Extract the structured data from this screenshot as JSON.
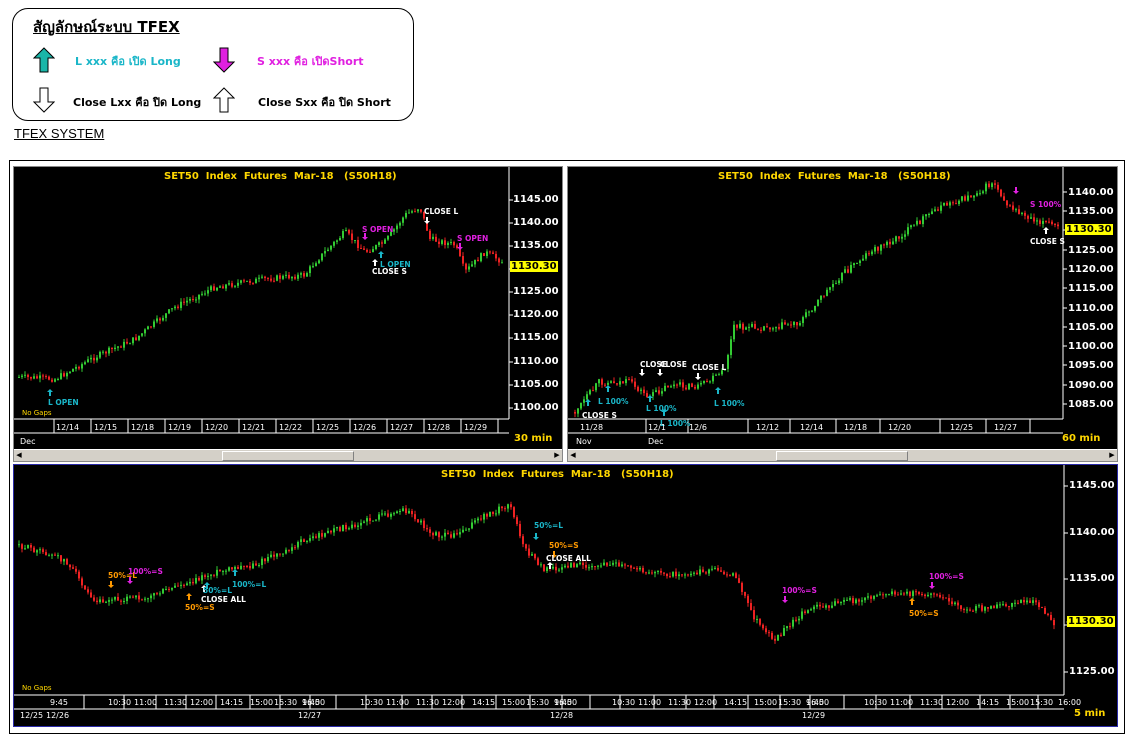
{
  "legend": {
    "title": "สัญลักษณ์ระบบ TFEX",
    "items": [
      {
        "label": "L xxx คือ เปิด Long",
        "color": "#1ab6c8",
        "icon": "up-arrow-teal"
      },
      {
        "label": "S xxx คือ เปิดShort",
        "color": "#e020e0",
        "icon": "down-arrow-magenta"
      },
      {
        "label": "Close Lxx คือ ปิด Long",
        "color": "#000000",
        "icon": "down-arrow-white"
      },
      {
        "label": "Close Sxx คือ ปิด Short",
        "color": "#000000",
        "icon": "up-arrow-white"
      }
    ]
  },
  "system_title": "TFEX SYSTEM",
  "colors": {
    "up": "#33cc33",
    "down": "#ee2222",
    "title": "#ffd700",
    "last_price_bg": "#ffff00",
    "long": "#1ab6c8",
    "short": "#e020e0",
    "half": "#ff9900",
    "close": "#ffffff"
  },
  "panels": [
    {
      "title": "SET50  Index  Futures  Mar-18   (S50H18)",
      "interval": "30  min",
      "no_gaps": "No Gaps",
      "last_price": "1130.30",
      "yticks": [
        "1145.00",
        "1140.00",
        "1135.00",
        "1130.00",
        "1125.00",
        "1120.00",
        "1115.00",
        "1110.00",
        "1105.00",
        "1100.00"
      ],
      "xticks": [
        "12/14",
        "12/15",
        "12/18",
        "12/19",
        "12/20",
        "12/21",
        "12/22",
        "12/25",
        "12/26",
        "12/27",
        "12/28",
        "12/29"
      ],
      "months": [
        "Dec"
      ],
      "signals": [
        {
          "text": "L  OPEN",
          "color": "#1ab6c8"
        },
        {
          "text": "S  OPEN",
          "color": "#e020e0"
        },
        {
          "text": "L  OPEN",
          "color": "#1ab6c8"
        },
        {
          "text": "CLOSE  S",
          "color": "#ffffff"
        },
        {
          "text": "CLOSE  L",
          "color": "#ffffff"
        },
        {
          "text": "S  OPEN",
          "color": "#e020e0"
        }
      ]
    },
    {
      "title": "SET50  Index  Futures  Mar-18   (S50H18)",
      "interval": "60  min",
      "last_price": "1130.30",
      "yticks": [
        "1140.00",
        "1135.00",
        "1130.00",
        "1125.00",
        "1120.00",
        "1115.00",
        "1110.00",
        "1105.00",
        "1100.00",
        "1095.00",
        "1090.00",
        "1085.00"
      ],
      "xticks": [
        "11/28",
        "12/1",
        "12/6",
        "12/12",
        "12/14",
        "12/18",
        "12/20",
        "12/25",
        "12/27"
      ],
      "months": [
        "Nov",
        "Dec"
      ],
      "signals": [
        {
          "text": "L  100%",
          "color": "#1ab6c8"
        },
        {
          "text": "CLOSE  S",
          "color": "#ffffff"
        },
        {
          "text": "CLOSE",
          "color": "#ffffff"
        },
        {
          "text": "CLOSE",
          "color": "#ffffff"
        },
        {
          "text": "L  100%",
          "color": "#1ab6c8"
        },
        {
          "text": "L  100%",
          "color": "#1ab6c8"
        },
        {
          "text": "CLOSE  L",
          "color": "#ffffff"
        },
        {
          "text": "L  100%",
          "color": "#1ab6c8"
        },
        {
          "text": "S  100%",
          "color": "#e020e0"
        },
        {
          "text": "CLOSE  S",
          "color": "#ffffff"
        }
      ]
    },
    {
      "title": "SET50  Index  Futures  Mar-18   (S50H18)",
      "interval": "5  min",
      "no_gaps": "No Gaps",
      "last_price": "1130.30",
      "yticks": [
        "1145.00",
        "1140.00",
        "1135.00",
        "1130.00",
        "1125.00"
      ],
      "xticks": [
        "9:45",
        "10:30",
        "11:00",
        "11:30",
        "12:00",
        "14:15",
        "15:00",
        "15:30",
        "16:00"
      ],
      "days": [
        "12/25",
        "12/26",
        "12/27",
        "12/28",
        "12/29"
      ],
      "signals": [
        {
          "text": "50%=L",
          "color": "#ff9900"
        },
        {
          "text": "100%=S",
          "color": "#e020e0"
        },
        {
          "text": "50%=S",
          "color": "#ff9900"
        },
        {
          "text": "50%=L",
          "color": "#1ab6c8"
        },
        {
          "text": "CLOSE  ALL",
          "color": "#ffffff"
        },
        {
          "text": "100%=L",
          "color": "#1ab6c8"
        },
        {
          "text": "50%=L",
          "color": "#1ab6c8"
        },
        {
          "text": "50%=S",
          "color": "#ff9900"
        },
        {
          "text": "CLOSE  ALL",
          "color": "#ffffff"
        },
        {
          "text": "100%=S",
          "color": "#e020e0"
        },
        {
          "text": "50%=S",
          "color": "#ff9900"
        },
        {
          "text": "100%=S",
          "color": "#e020e0"
        }
      ]
    }
  ]
}
